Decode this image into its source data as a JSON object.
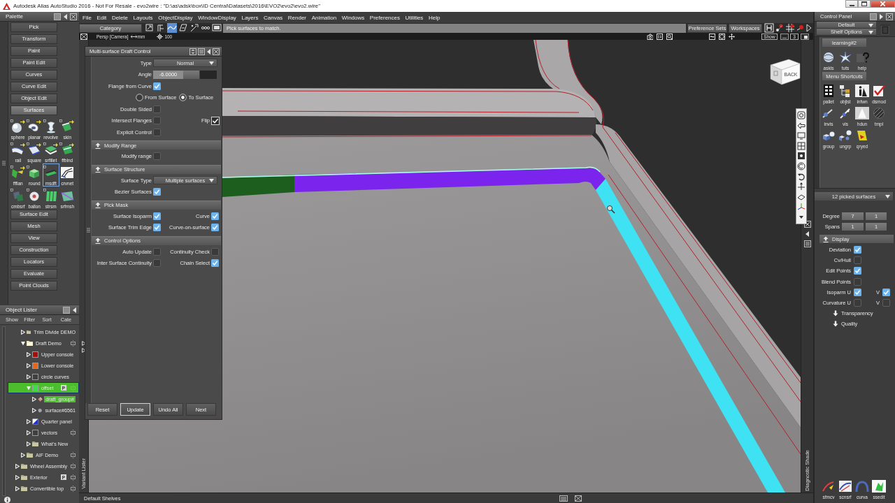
{
  "window": {
    "title": "Autodesk Alias AutoStudio 2016 - Not For Resale - evo2wire : \"D:\\as\\adsk\\box\\ID Central\\Datasets\\2016\\EVO2\\evo2\\evo2.wire\""
  },
  "palette": {
    "title": "Palette",
    "sections": [
      {
        "label": "Pick",
        "expanded": false
      },
      {
        "label": "Transform",
        "expanded": false
      },
      {
        "label": "Paint",
        "expanded": false
      },
      {
        "label": "Paint Edit",
        "expanded": false
      },
      {
        "label": "Curves",
        "expanded": false
      },
      {
        "label": "Curve Edit",
        "expanded": false
      },
      {
        "label": "Object Edit",
        "expanded": false
      },
      {
        "label": "Surfaces",
        "expanded": true,
        "tools": [
          {
            "label": "sphere",
            "selected": false
          },
          {
            "label": "planar",
            "selected": false
          },
          {
            "label": "revolve",
            "selected": false
          },
          {
            "label": "skin",
            "selected": false
          },
          {
            "label": "rail",
            "selected": false
          },
          {
            "label": "square",
            "selected": false
          },
          {
            "label": "srfillet",
            "selected": false
          },
          {
            "label": "ffblnd",
            "selected": false
          },
          {
            "label": "ffflan",
            "selected": false
          },
          {
            "label": "round",
            "selected": false
          },
          {
            "label": "msdft",
            "selected": true
          },
          {
            "label": "crvnet",
            "selected": false
          },
          {
            "label": "cmbsrf",
            "selected": false
          },
          {
            "label": "ballon",
            "selected": false
          },
          {
            "label": "strsm",
            "selected": false
          },
          {
            "label": "srfmsh",
            "selected": false
          }
        ]
      },
      {
        "label": "Surface Edit",
        "expanded": false
      },
      {
        "label": "Mesh",
        "expanded": false
      },
      {
        "label": "View",
        "expanded": false
      },
      {
        "label": "Construction",
        "expanded": false
      },
      {
        "label": "Locators",
        "expanded": false
      },
      {
        "label": "Evaluate",
        "expanded": false
      },
      {
        "label": "Point Clouds",
        "expanded": false
      }
    ]
  },
  "object_lister": {
    "title": "Object Lister",
    "menu": [
      "Show",
      "Filter",
      "Sort",
      "Cate"
    ],
    "tree": [
      {
        "children": [
          {
            "label": "Trim Divide DEMO",
            "kind": "folder",
            "expanded": false,
            "selected": false,
            "toggle": false
          },
          {
            "label": "Draft Demo",
            "kind": "folder",
            "expanded": true,
            "selected": false,
            "toggle": true,
            "children": [
              {
                "label": "Upper console",
                "kind": "layer",
                "color": "#a80d0d",
                "expanded": false,
                "selected": false,
                "toggle": false
              },
              {
                "label": "Lower console",
                "kind": "layer",
                "color": "#e8651a",
                "expanded": false,
                "selected": false,
                "toggle": false
              },
              {
                "label": "circle curves",
                "kind": "layer",
                "color": "#3f3f3f",
                "expanded": false,
                "selected": false,
                "toggle": false
              },
              {
                "label": "offset",
                "kind": "layer",
                "color": "#3ddc4a",
                "expanded": true,
                "selected": true,
                "badge": "P",
                "toggle": true,
                "children": [
                  {
                    "label": "draft_group#",
                    "kind": "group",
                    "expanded": false,
                    "selected": true,
                    "toggle": false
                  },
                  {
                    "label": "surface#6561",
                    "kind": "surface",
                    "expanded": false,
                    "selected": false,
                    "toggle": false
                  }
                ]
              },
              {
                "label": "Quarter panel",
                "kind": "shader",
                "expanded": false,
                "selected": false,
                "toggle": false
              },
              {
                "label": "vectors",
                "kind": "layer",
                "color": "#3f3f3f",
                "expanded": false,
                "selected": false,
                "toggle": true
              },
              {
                "label": "What's New",
                "kind": "folder",
                "expanded": false,
                "selected": false,
                "toggle": false
              }
            ]
          },
          {
            "label": "AIF Demo",
            "kind": "folder",
            "expanded": false,
            "selected": false,
            "toggle": true
          }
        ]
      },
      {
        "label": "Wheel Assembly",
        "kind": "folder",
        "expanded": false,
        "selected": false,
        "toggle": true
      },
      {
        "label": "Exterior",
        "kind": "folder",
        "expanded": false,
        "selected": false,
        "badge": "P",
        "toggle": true
      },
      {
        "label": "Convertible top",
        "kind": "folder",
        "expanded": false,
        "selected": false,
        "toggle": true
      }
    ]
  },
  "menu_bar": [
    "File",
    "Edit",
    "Delete",
    "Layouts",
    "ObjectDisplay",
    "WindowDisplay",
    "Layers",
    "Canvas",
    "Render",
    "Animation",
    "Windows",
    "Preferences",
    "Utilities",
    "Help"
  ],
  "toolbar": {
    "category": "Category",
    "tools": [
      {
        "selected": false
      },
      {
        "selected": false
      },
      {
        "selected": true
      },
      {
        "selected": false
      },
      {
        "selected": false
      },
      {
        "selected": false
      },
      {
        "selected": false
      }
    ],
    "prompt": "Pick surfaces to match.",
    "buttons": [
      "Preference Sets",
      "Workspaces"
    ]
  },
  "viewport": {
    "camera": "Persp [Camera]",
    "units": "mm",
    "grid": "100",
    "show": "Show",
    "layout": "3",
    "view_cube": "BACK",
    "left_tab": "Variant Lister",
    "right_tab": "Diagnostic Shade"
  },
  "draft_control": {
    "title": "Multi-surface Draft Control",
    "rows": [
      {
        "kind": "dropdown",
        "label": "Type",
        "value": "Normal"
      },
      {
        "kind": "slider",
        "label": "Angle",
        "value": "-6.0000",
        "level": 0.5
      },
      {
        "kind": "checkbox",
        "label": "Flange from Curve",
        "checked": true
      },
      {
        "kind": "radio",
        "options": [
          {
            "label": "From Surface",
            "selected": false
          },
          {
            "label": "To Surface",
            "selected": true
          }
        ]
      },
      {
        "kind": "checkbox",
        "label": "Double Sided",
        "checked": false
      },
      {
        "kind": "checkbox",
        "label": "Intersect Flanges",
        "checked": false,
        "side": {
          "kind": "tick",
          "label": "Flip",
          "checked": true
        }
      },
      {
        "kind": "checkbox",
        "label": "Explicit Control",
        "checked": false
      }
    ],
    "sections": [
      {
        "title": "Modify Range",
        "expanded": true,
        "rows": [
          {
            "kind": "checkbox",
            "label": "Modify range",
            "checked": false
          }
        ]
      },
      {
        "title": "Surface Structure",
        "expanded": true,
        "rows": [
          {
            "kind": "dropdown",
            "label": "Surface Type",
            "value": "Multiple surfaces"
          },
          {
            "kind": "checkbox",
            "label": "Bezier Surfaces",
            "checked": true
          }
        ]
      },
      {
        "title": "Pick Mask",
        "expanded": true,
        "rows": [
          {
            "kind": "checkbox",
            "label": "Surface Isoparm",
            "checked": true,
            "side": {
              "kind": "checkbox",
              "label": "Curve",
              "checked": true
            }
          },
          {
            "kind": "checkbox",
            "label": "Surface Trim Edge",
            "checked": true,
            "side": {
              "kind": "checkbox",
              "label": "Curve-on-surface",
              "checked": true
            }
          }
        ]
      },
      {
        "title": "Control Options",
        "expanded": true,
        "rows": [
          {
            "kind": "checkbox",
            "label": "Auto Update",
            "checked": false,
            "side": {
              "kind": "checkbox",
              "label": "Continuity Check",
              "checked": false
            }
          },
          {
            "kind": "checkbox",
            "label": "Inter Surface Continuity",
            "checked": false,
            "side": {
              "kind": "checkbox",
              "label": "Chain Select",
              "checked": true
            }
          }
        ]
      }
    ],
    "buttons": [
      {
        "label": "Reset",
        "focused": false
      },
      {
        "label": "Update",
        "focused": true
      },
      {
        "label": "Undo All",
        "focused": false
      },
      {
        "label": "Next",
        "focused": false
      }
    ]
  },
  "control_panel": {
    "title": "Control Panel",
    "dropdowns": [
      "Default",
      "Shelf Options"
    ],
    "shelves": [
      {
        "title": "learning#2",
        "tools": [
          "askls",
          "tuts",
          "help"
        ]
      },
      {
        "title": "Menu Shortcuts",
        "tools": [
          "pallet",
          "objlst",
          "infwn",
          "dsmod",
          "invis",
          "vis",
          "hdun",
          "tmpl",
          "group",
          "ungrp",
          "qryed"
        ]
      }
    ],
    "selection": "12 picked surfaces",
    "parameters": [
      {
        "label": "Degree",
        "values": [
          "7",
          "1"
        ]
      },
      {
        "label": "Spans",
        "values": [
          "1",
          "1"
        ]
      }
    ],
    "display": {
      "title": "Display",
      "expanded": true,
      "rows": [
        {
          "label": "Deviation",
          "checked": true
        },
        {
          "label": "Cv/Hull",
          "checked": false
        },
        {
          "label": "Edit Points",
          "checked": true
        },
        {
          "label": "Blend Points",
          "checked": false
        },
        {
          "label": "Isoparm U",
          "checked": true,
          "side": {
            "label": "V",
            "checked": true
          }
        },
        {
          "label": "Curvature U",
          "checked": false,
          "side": {
            "label": "V",
            "checked": false
          }
        }
      ],
      "subsections": [
        {
          "title": "Transparency",
          "expanded": false
        },
        {
          "title": "Quality",
          "expanded": false
        }
      ]
    },
    "bottom_tools": [
      "sfmcv",
      "scnsrf",
      "curva",
      "ssedit"
    ]
  },
  "shelf_bar": {
    "title": "Default Shelves"
  }
}
